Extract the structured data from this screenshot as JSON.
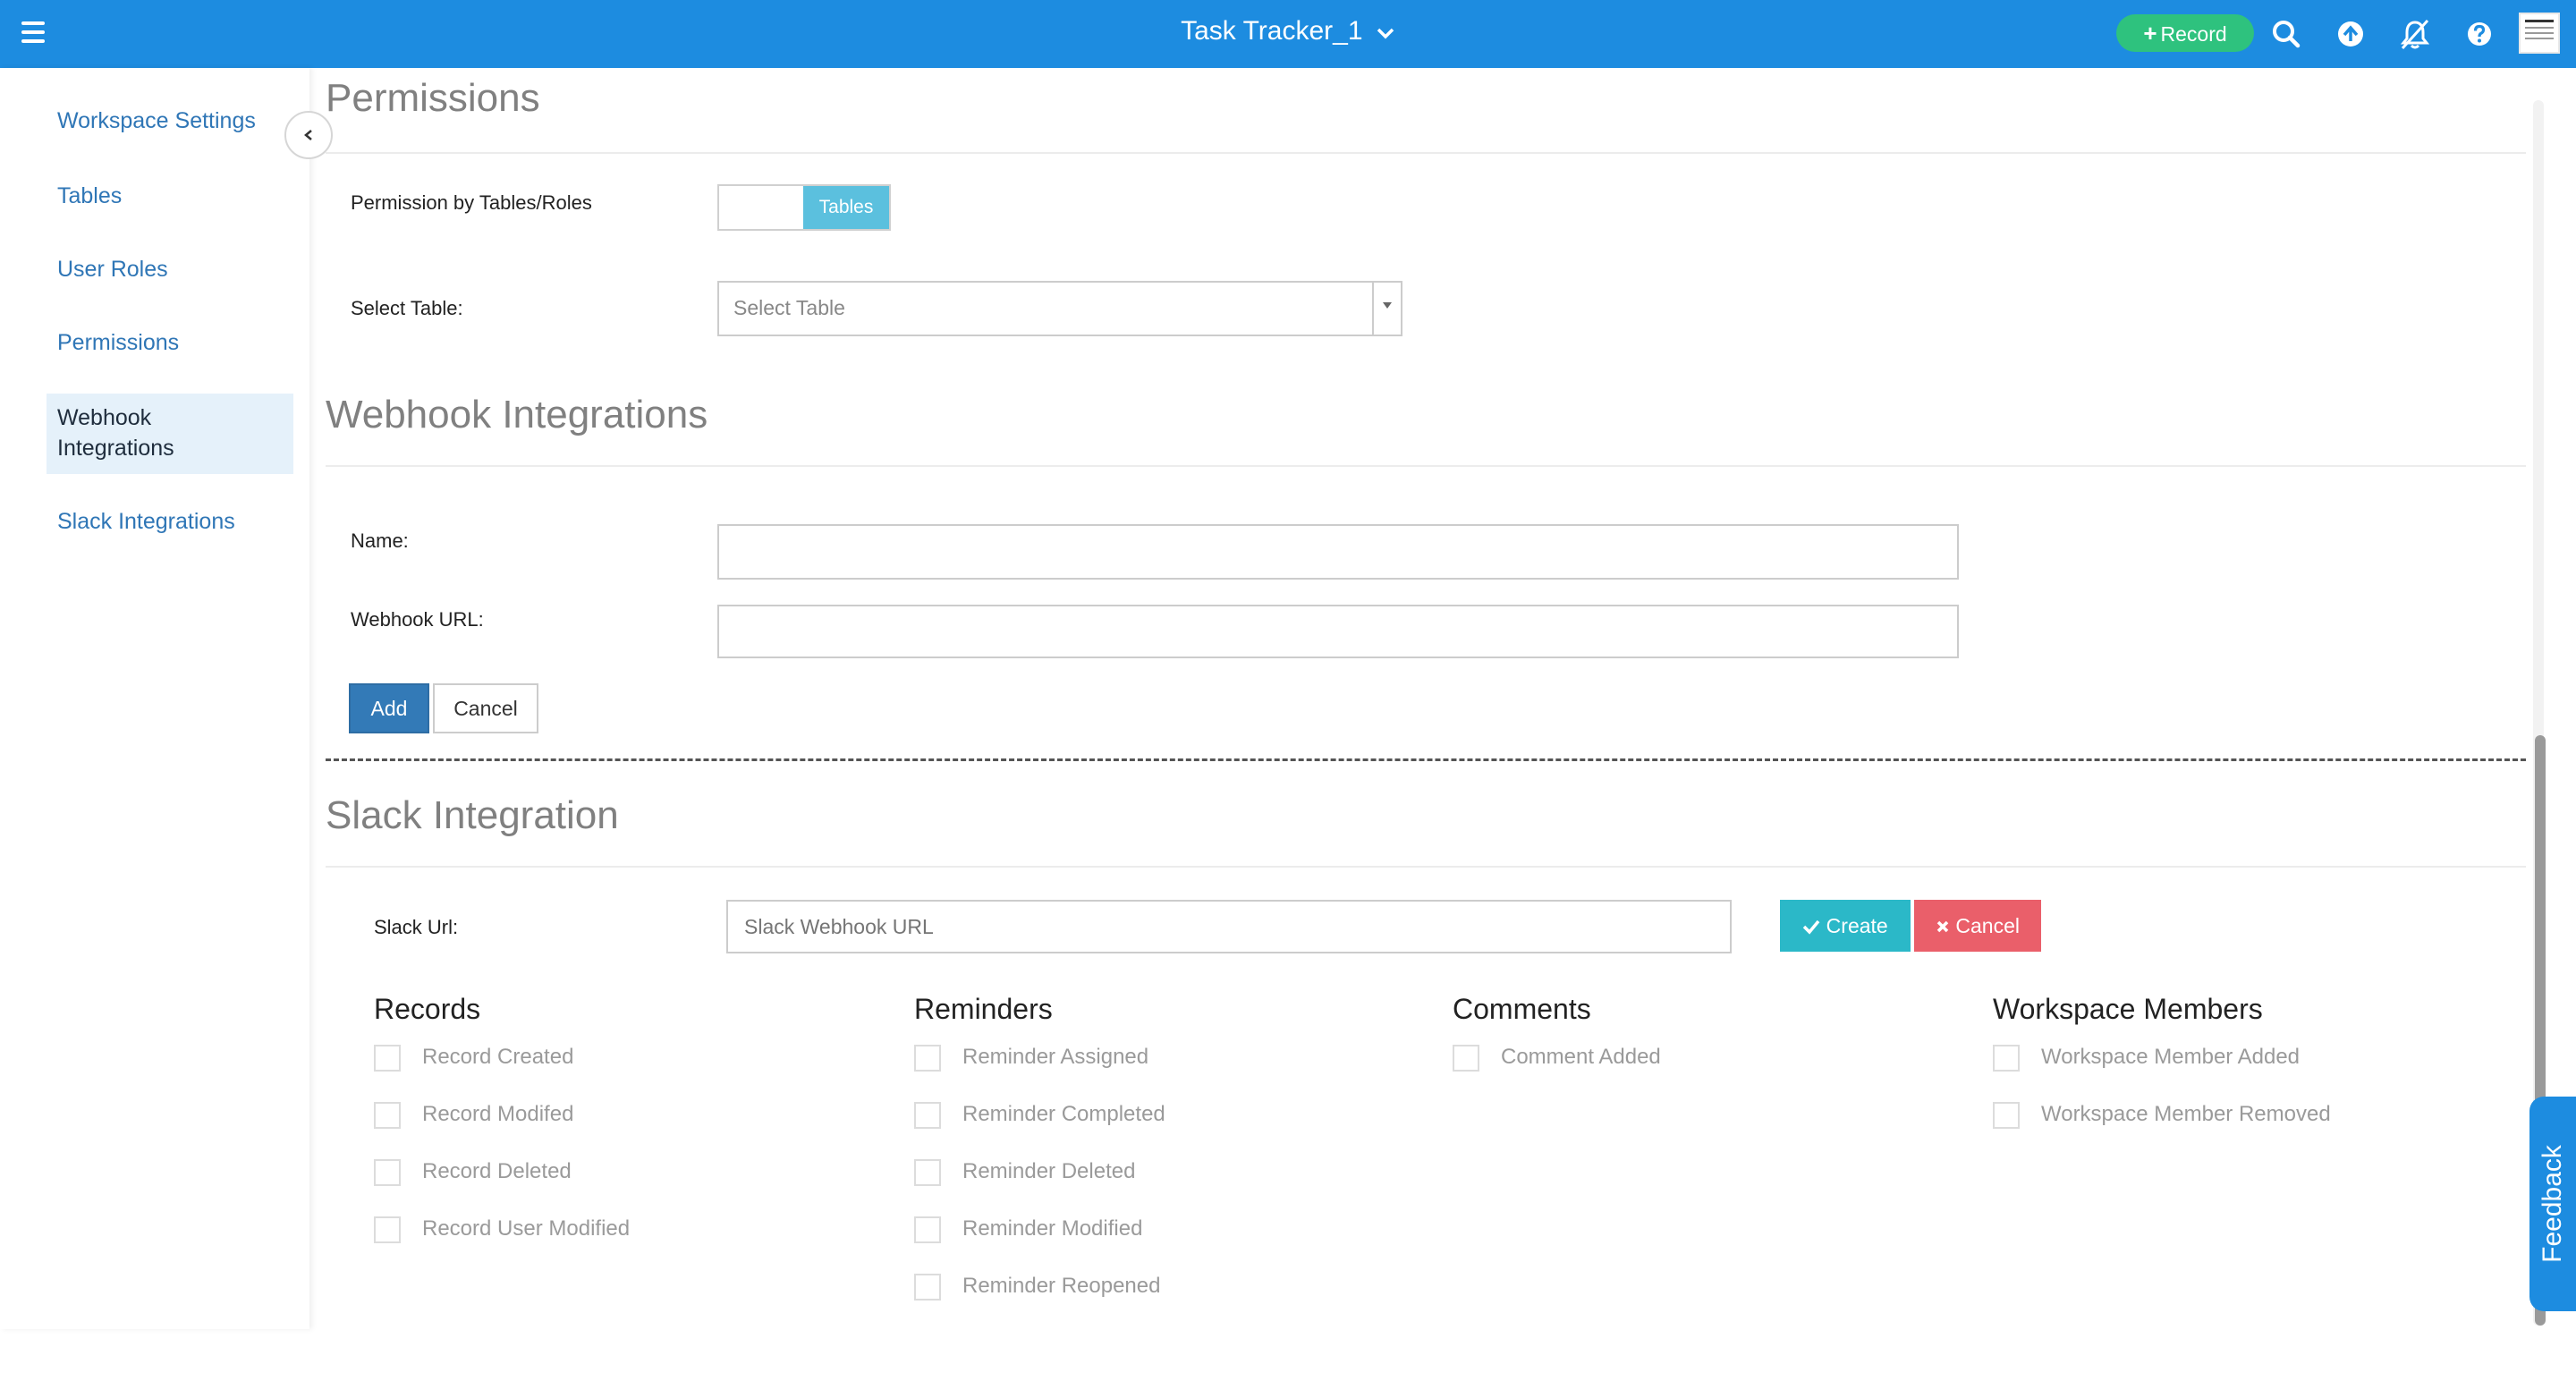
{
  "header": {
    "title": "Task Tracker_1",
    "record_label": "Record",
    "icons": [
      "menu-icon",
      "chevron-down-icon",
      "plus-icon",
      "search-icon",
      "upload-icon",
      "notifications-off-icon",
      "help-icon",
      "user-avatar"
    ],
    "color": "#1d8ce0"
  },
  "sidebar": {
    "items": [
      {
        "label": "Workspace Settings"
      },
      {
        "label": "Tables"
      },
      {
        "label": "User Roles"
      },
      {
        "label": "Permissions"
      },
      {
        "label": "Webhook Integrations",
        "line1": "Webhook",
        "line2": "Integrations",
        "active": true
      },
      {
        "label": "Slack Integrations"
      }
    ]
  },
  "permissions": {
    "heading": "Permissions",
    "by_label": "Permission by Tables/Roles",
    "toggle_label": "Tables",
    "select_label": "Select Table:",
    "select_placeholder": "Select Table"
  },
  "webhook": {
    "heading": "Webhook Integrations",
    "name_label": "Name:",
    "name_value": "",
    "url_label": "Webhook URL:",
    "url_value": "",
    "add_label": "Add",
    "cancel_label": "Cancel"
  },
  "slack": {
    "heading": "Slack Integration",
    "url_label": "Slack Url:",
    "url_placeholder": "Slack Webhook URL",
    "create_label": "Create",
    "cancel_label": "Cancel",
    "create_color": "#2bb8c8",
    "cancel_color": "#ea5f6a",
    "groups": [
      {
        "title": "Records",
        "items": [
          "Record Created",
          "Record Modifed",
          "Record Deleted",
          "Record User Modified"
        ]
      },
      {
        "title": "Reminders",
        "items": [
          "Reminder Assigned",
          "Reminder Completed",
          "Reminder Deleted",
          "Reminder Modified",
          "Reminder Reopened"
        ]
      },
      {
        "title": "Comments",
        "items": [
          "Comment Added"
        ]
      },
      {
        "title": "Workspace Members",
        "items": [
          "Workspace Member Added",
          "Workspace Member Removed"
        ]
      }
    ]
  },
  "feedback": {
    "label": "Feedback"
  }
}
